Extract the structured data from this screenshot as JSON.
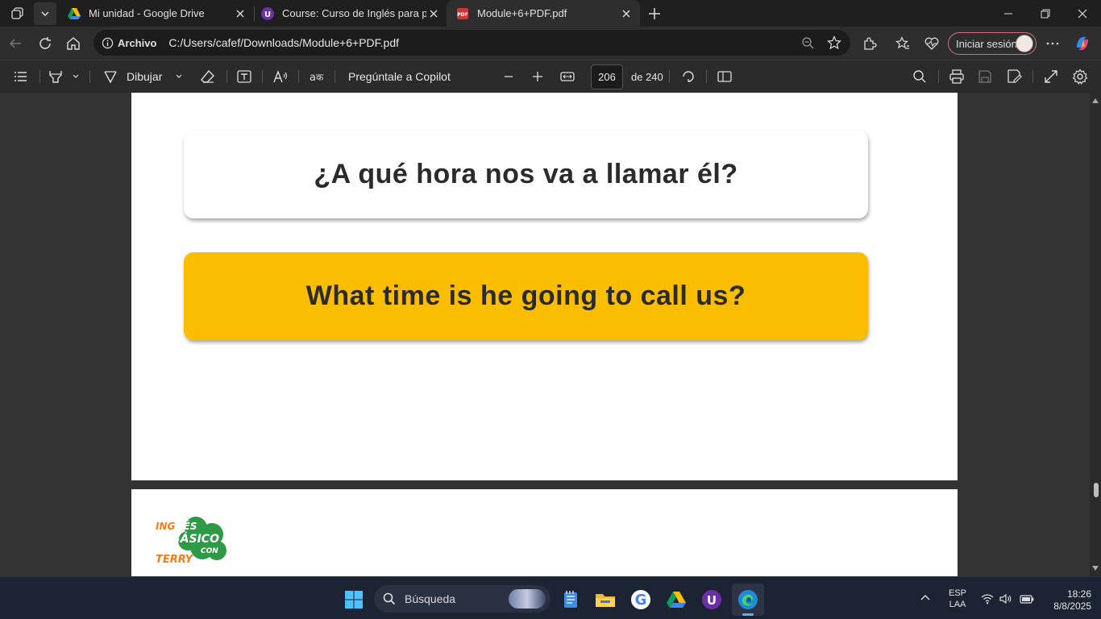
{
  "tabs": [
    {
      "title": "Mi unidad - Google Drive",
      "icon": "google-drive-icon",
      "active": false
    },
    {
      "title": "Course: Curso de Inglés para principiantes",
      "icon": "course-site-icon",
      "active": false
    },
    {
      "title": "Module+6+PDF.pdf",
      "icon": "pdf-icon",
      "active": true
    }
  ],
  "address": {
    "info_label": "Archivo",
    "url": "C:/Users/cafef/Downloads/Module+6+PDF.pdf"
  },
  "browser": {
    "signin_label": "Iniciar sesión"
  },
  "pdf_toolbar": {
    "draw_label": "Dibujar",
    "copilot_label": "Pregúntale a Copilot",
    "page_current": "206",
    "page_total": "de 240"
  },
  "page": {
    "spanish_sentence": "¿A qué hora nos va a llamar él?",
    "english_sentence": "What time is he going to call us?",
    "accent_color": "#fbbd00",
    "logo_text": {
      "line1": "INGLÉS",
      "line2": "BÁSICO",
      "line3": "CON",
      "line4": "TERRY"
    }
  },
  "taskbar": {
    "search_placeholder": "Búsqueda",
    "language": "ESP",
    "language_sub": "LAA",
    "time": "18:26",
    "date": "8/8/2025"
  }
}
